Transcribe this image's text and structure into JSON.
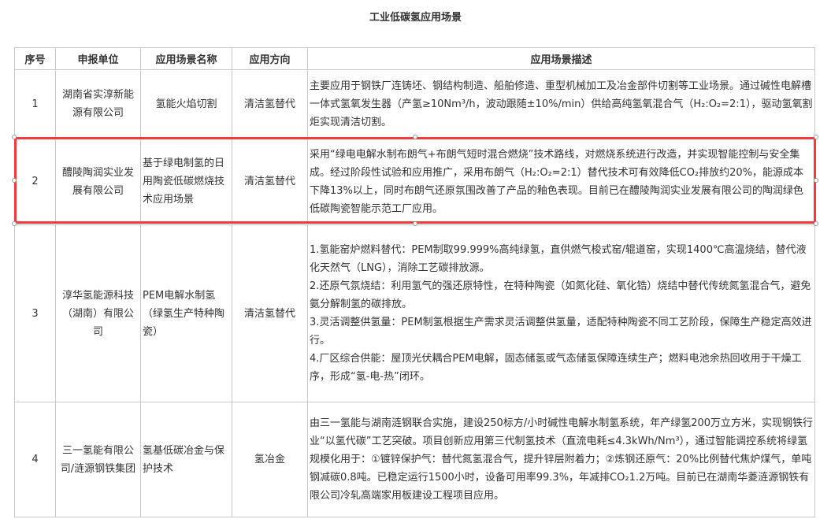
{
  "title": "工业低碳氢应用场景",
  "headers": [
    "序号",
    "申报单位",
    "应用场景名称",
    "应用方向",
    "应用场景描述"
  ],
  "rows": [
    {
      "no": "1",
      "unit": "湖南省实淳新能源有限公司",
      "scenario": "氢能火焰切割",
      "direction": "清洁氢替代",
      "desc": "主要应用于钢铁厂连铸坯、钢结构制造、船舶修造、重型机械加工及冶金部件切割等工业场景。通过碱性电解槽一体式氢氧发生器（产氢≥10Nm³/h，波动跟随±10%/min）供给高纯氢氧混合气（H₂:O₂=2:1），驱动氢氧割炬实现清洁切割。"
    },
    {
      "no": "2",
      "unit": "醴陵陶润实业发展有限公司",
      "scenario": "基于绿电制氢的日用陶瓷低碳燃烧技术应用场景",
      "direction": "清洁氢替代",
      "desc": "采用“绿电电解水制布朗气+布朗气短时混合燃烧”技术路线，对燃烧系统进行改造，并实现智能控制与安全集成。经过阶段性试验和应用推广，采用布朗气（H₂:O₂=2:1）替代技术可有效降低CO₂排放约20%，能源成本下降13%以上，同时布朗气还原氛围改善了产品的釉色表现。目前已在醴陵陶润实业发展有限公司的陶润绿色低碳陶瓷智能示范工厂应用。"
    },
    {
      "no": "3",
      "unit": "淳华氢能源科技（湖南）有限公司",
      "scenario": "PEM电解水制氢（绿氢生产特种陶瓷）",
      "direction": "清洁氢替代",
      "desc_lines": [
        "1.氢能窑炉燃料替代：PEM制取99.999%高纯绿氢，直供燃气梭式窑/辊道窑，实现1400℃高温烧结，替代液化天然气（LNG），消除工艺碳排放源。",
        "2.还原气氛烧结：利用氢气的强还原特性，在特种陶瓷（如氮化硅、氧化锆）烧结中替代传统氮氢混合气，避免氨分解制氢的碳排放。",
        "3.灵活调整供氢量：PEM制氢根据生产需求灵活调整供氢量，适配特种陶瓷不同工艺阶段，保障生产稳定高效进行。",
        "4.厂区综合供能：屋顶光伏耦合PEM电解，固态储氢或气态储氢保障连续生产；燃料电池余热回收用于干燥工序，形成“氢-电-热”闭环。"
      ]
    },
    {
      "no": "4",
      "unit": "三一氢能有限公司/涟源钢铁集团",
      "scenario": "氢基低碳冶金与保护技术",
      "direction": "氢冶金",
      "desc": "由三一氢能与湖南涟钢联合实施，建设250标方/小时碱性电解水制氢系统，年产绿氢200万立方米，实现钢铁行业“以氢代碳”工艺突破。项目创新应用第三代制氢技术（直流电耗≤4.3kWh/Nm³），通过智能调控系统将绿氢规模化用于：①镀锌保护气：替代氮氢混合气，提升锌层附着力；②炼钢还原气：20%比例替代焦炉煤气，单吨钢减碳0.8吨。已稳定运行1500小时，设备可用率99.3%，年减排CO₂1.2万吨。目前已在湖南华菱涟源钢铁有限公司冷轧高端家用板建设工程项目应用。"
    }
  ]
}
